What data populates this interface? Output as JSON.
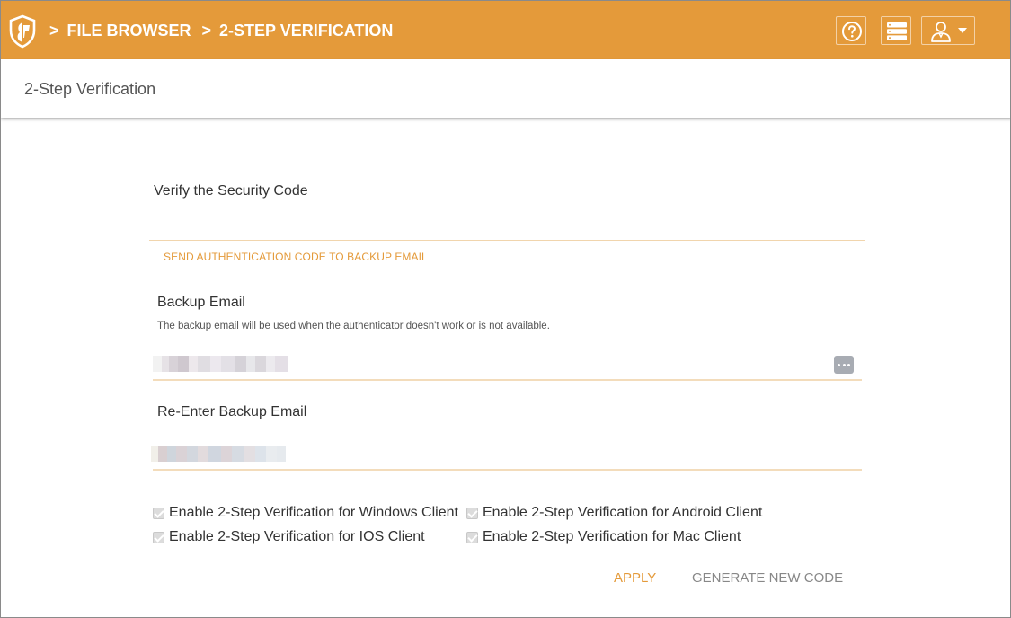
{
  "header": {
    "logo": "shield-logo-icon",
    "breadcrumb": [
      {
        "sep": ">",
        "label": "FILE BROWSER"
      },
      {
        "sep": ">",
        "label": "2-STEP VERIFICATION"
      }
    ],
    "buttons": [
      {
        "icon": "help-circle-icon"
      },
      {
        "icon": "server-list-icon"
      },
      {
        "icon": "user-icon",
        "dropdown": "caret-down-icon"
      }
    ],
    "color": "#e49a3a"
  },
  "subheader": {
    "title": "2-Step Verification"
  },
  "form": {
    "verify_title": "Verify the Security Code",
    "code_value": "",
    "send_link": "SEND AUTHENTICATION CODE TO BACKUP EMAIL",
    "backup_email": {
      "label": "Backup Email",
      "hint": "The backup email will be used when the authenticator doesn't work or is not available.",
      "value_redacted": true,
      "action_icon": "more-dots-icon"
    },
    "reenter_email": {
      "label": "Re-Enter Backup Email",
      "value_redacted": true
    },
    "checkboxes": [
      {
        "label": "Enable 2-Step Verification for Windows Client",
        "checked": true
      },
      {
        "label": "Enable 2-Step Verification for Android Client",
        "checked": true
      },
      {
        "label": "Enable 2-Step Verification for IOS Client",
        "checked": true
      },
      {
        "label": "Enable 2-Step Verification for Mac Client",
        "checked": true
      }
    ],
    "apply_label": "APPLY",
    "generate_label": "GENERATE NEW CODE"
  }
}
